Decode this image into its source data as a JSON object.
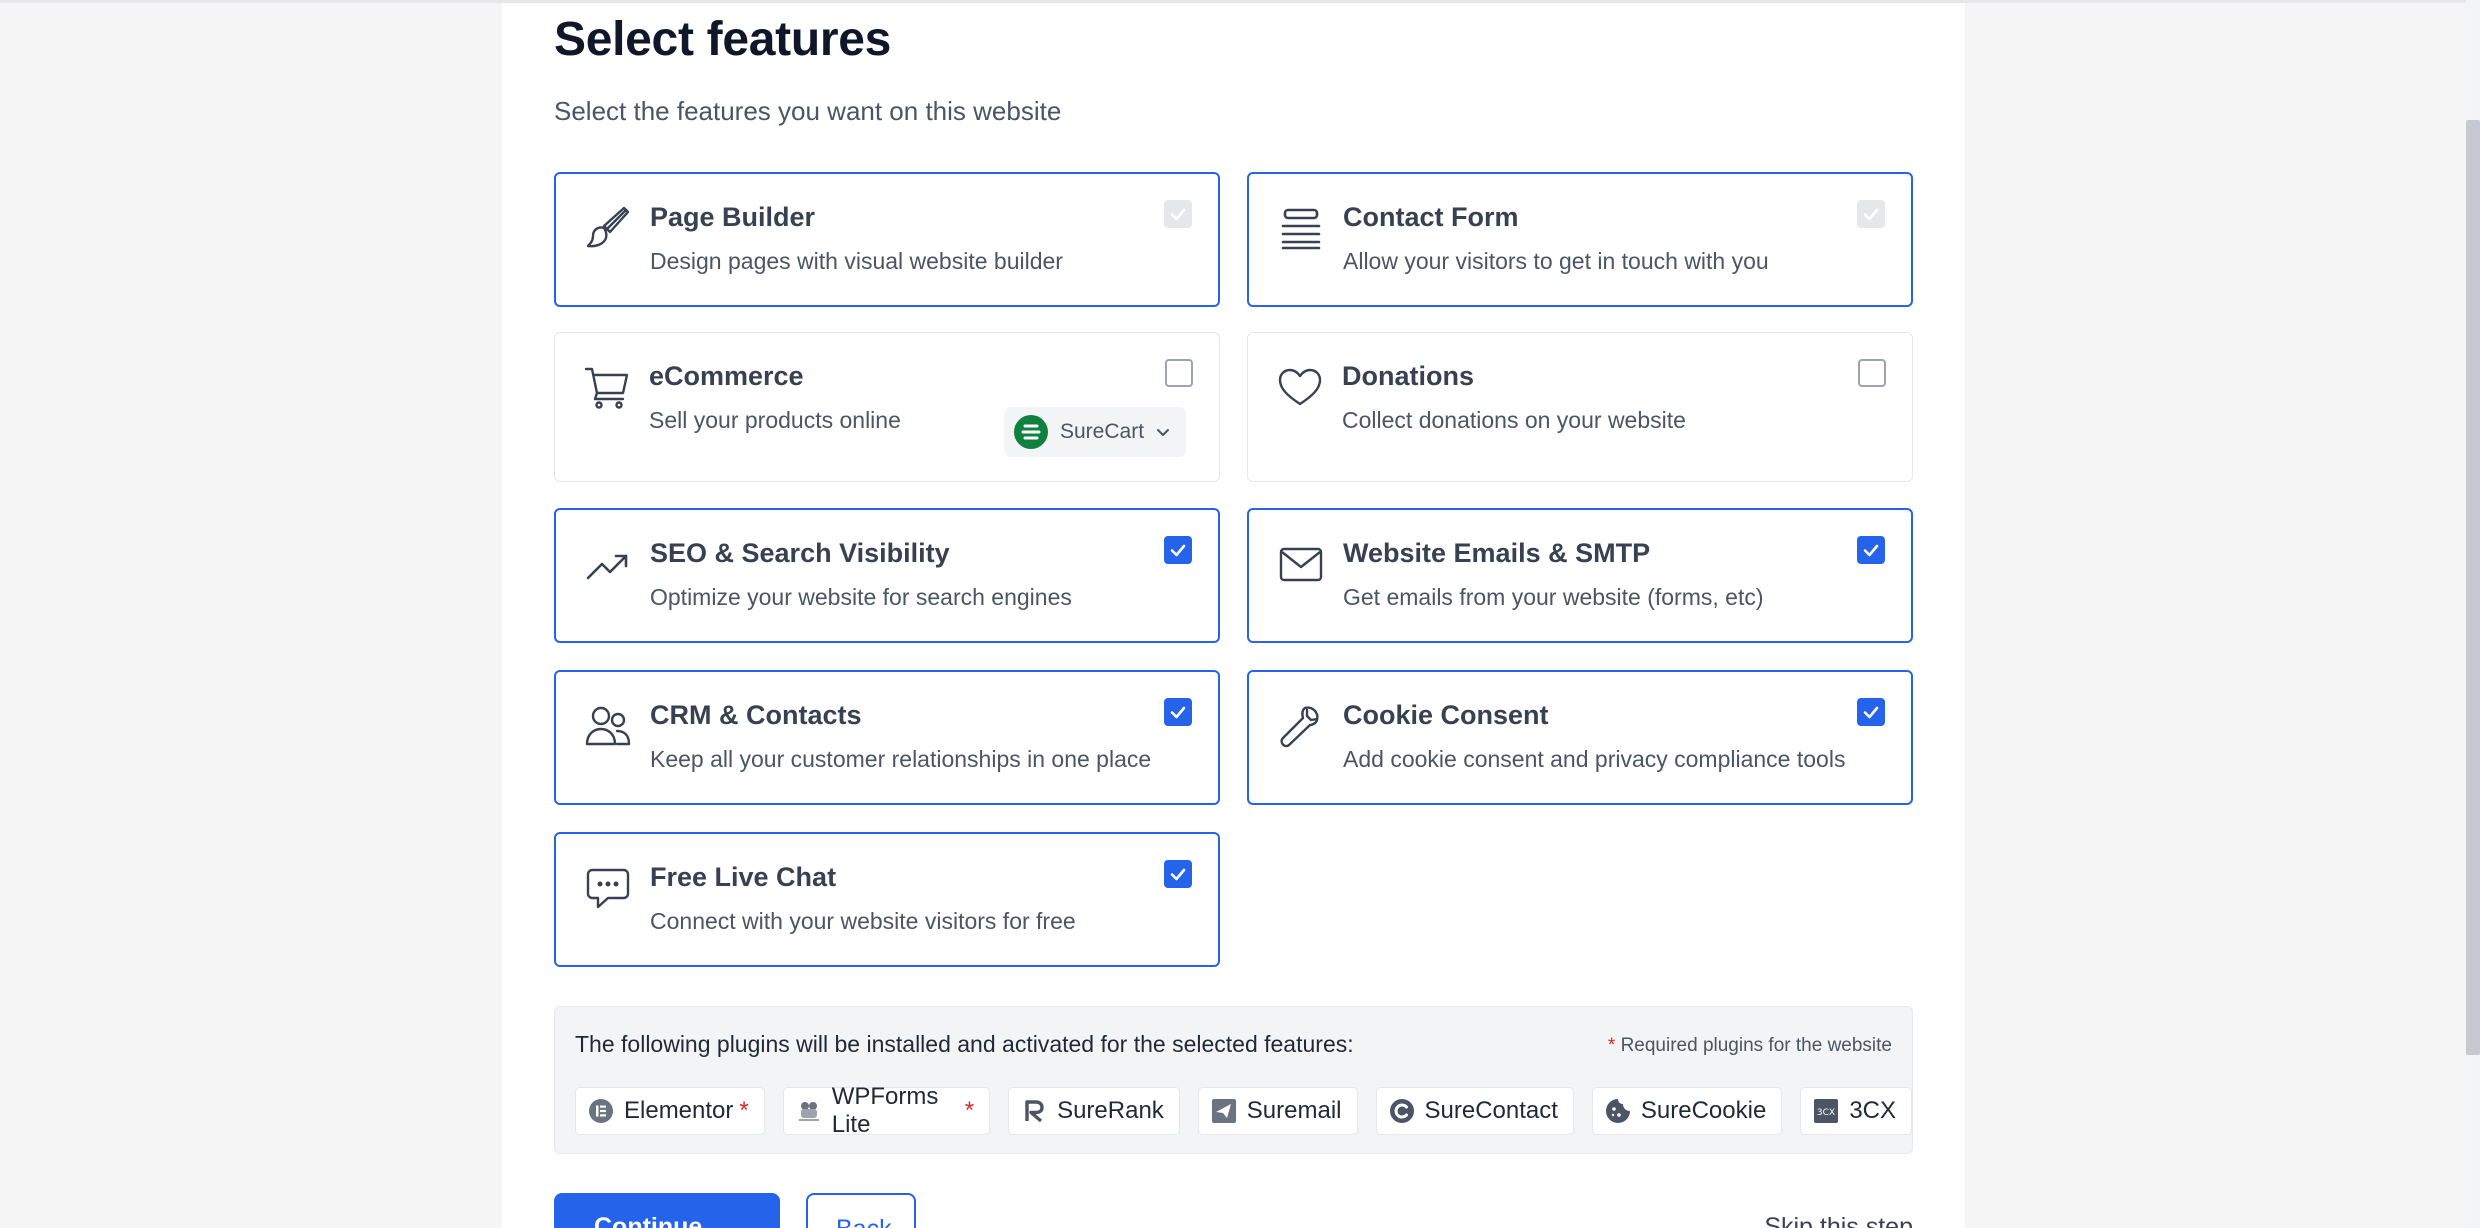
{
  "header": {
    "title": "Select features",
    "subtitle": "Select the features you want on this website"
  },
  "features": [
    {
      "title": "Page Builder",
      "description": "Design pages with visual website builder",
      "icon": "paintbrush-icon",
      "state": "checked-disabled"
    },
    {
      "title": "Contact Form",
      "description": "Allow your visitors to get in touch with you",
      "icon": "form-lines-icon",
      "state": "checked-disabled"
    },
    {
      "title": "eCommerce",
      "description": "Sell your products online",
      "icon": "cart-icon",
      "state": "unchecked",
      "provider": {
        "label": "SureCart",
        "icon": "surecart-logo-icon",
        "color": "#10803f"
      }
    },
    {
      "title": "Donations",
      "description": "Collect donations on your website",
      "icon": "heart-icon",
      "state": "unchecked"
    },
    {
      "title": "SEO & Search Visibility",
      "description": "Optimize your website for search engines",
      "icon": "trend-up-icon",
      "state": "checked"
    },
    {
      "title": "Website Emails & SMTP",
      "description": "Get emails from your website (forms, etc)",
      "icon": "mail-icon",
      "state": "checked"
    },
    {
      "title": "CRM & Contacts",
      "description": "Keep all your customer relationships in one place",
      "icon": "users-icon",
      "state": "checked"
    },
    {
      "title": "Cookie Consent",
      "description": "Add cookie consent and privacy compliance tools",
      "icon": "wrench-icon",
      "state": "checked"
    },
    {
      "title": "Free Live Chat",
      "description": "Connect with your website visitors for free",
      "icon": "chat-icon",
      "state": "checked"
    }
  ],
  "plugins": {
    "intro": "The following plugins will be installed and activated for the selected features:",
    "required_note": "Required plugins for the website",
    "required_mark": "*",
    "items": [
      {
        "name": "Elementor",
        "required": true,
        "icon": "elementor-icon"
      },
      {
        "name": "WPForms Lite",
        "required": true,
        "icon": "wpforms-icon"
      },
      {
        "name": "SureRank",
        "required": false,
        "icon": "surerank-icon"
      },
      {
        "name": "Suremail",
        "required": false,
        "icon": "suremail-icon"
      },
      {
        "name": "SureContact",
        "required": false,
        "icon": "surecontact-icon"
      },
      {
        "name": "SureCookie",
        "required": false,
        "icon": "surecookie-icon"
      },
      {
        "name": "3CX",
        "required": false,
        "icon": "3cx-icon"
      }
    ]
  },
  "actions": {
    "continue_label": "Continue →",
    "back_label": "Back",
    "skip_label": "Skip this step"
  },
  "colors": {
    "accent": "#2563eb",
    "required_star": "#dc2626"
  }
}
